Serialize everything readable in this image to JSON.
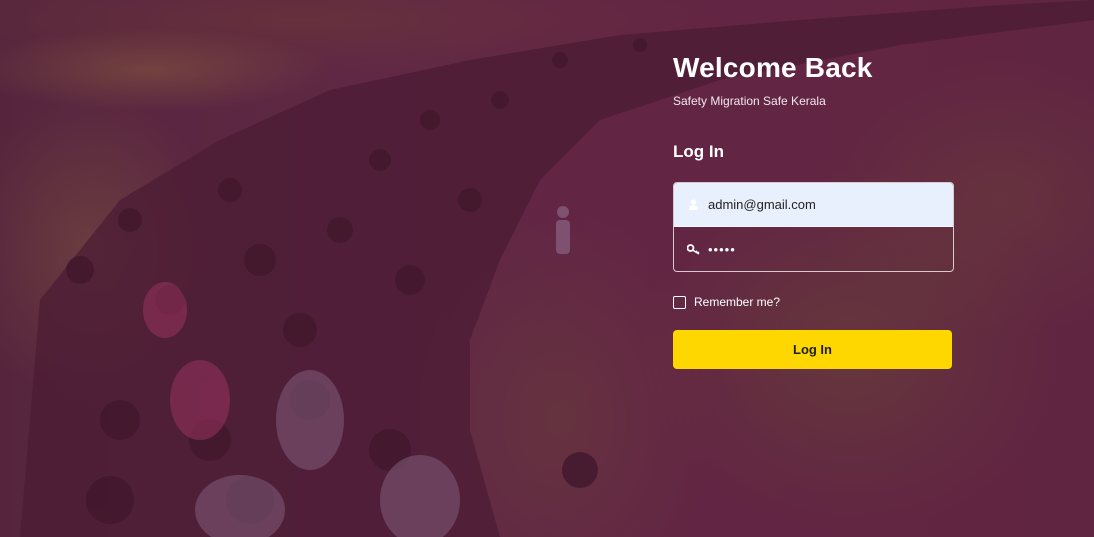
{
  "header": {
    "title": "Welcome Back",
    "subtitle": "Safety Migration Safe Kerala"
  },
  "login": {
    "section_title": "Log In",
    "email_value": "admin@gmail.com",
    "email_icon": "user-icon",
    "password_value": "•••••",
    "password_icon": "key-icon",
    "remember_label": "Remember me?",
    "remember_checked": false,
    "submit_label": "Log In"
  },
  "colors": {
    "accent_button": "#ffd700",
    "overlay_tint": "#6e1c46",
    "input_autofill_bg": "#e8f0fe"
  },
  "background": {
    "icon": "crowd-photo"
  }
}
